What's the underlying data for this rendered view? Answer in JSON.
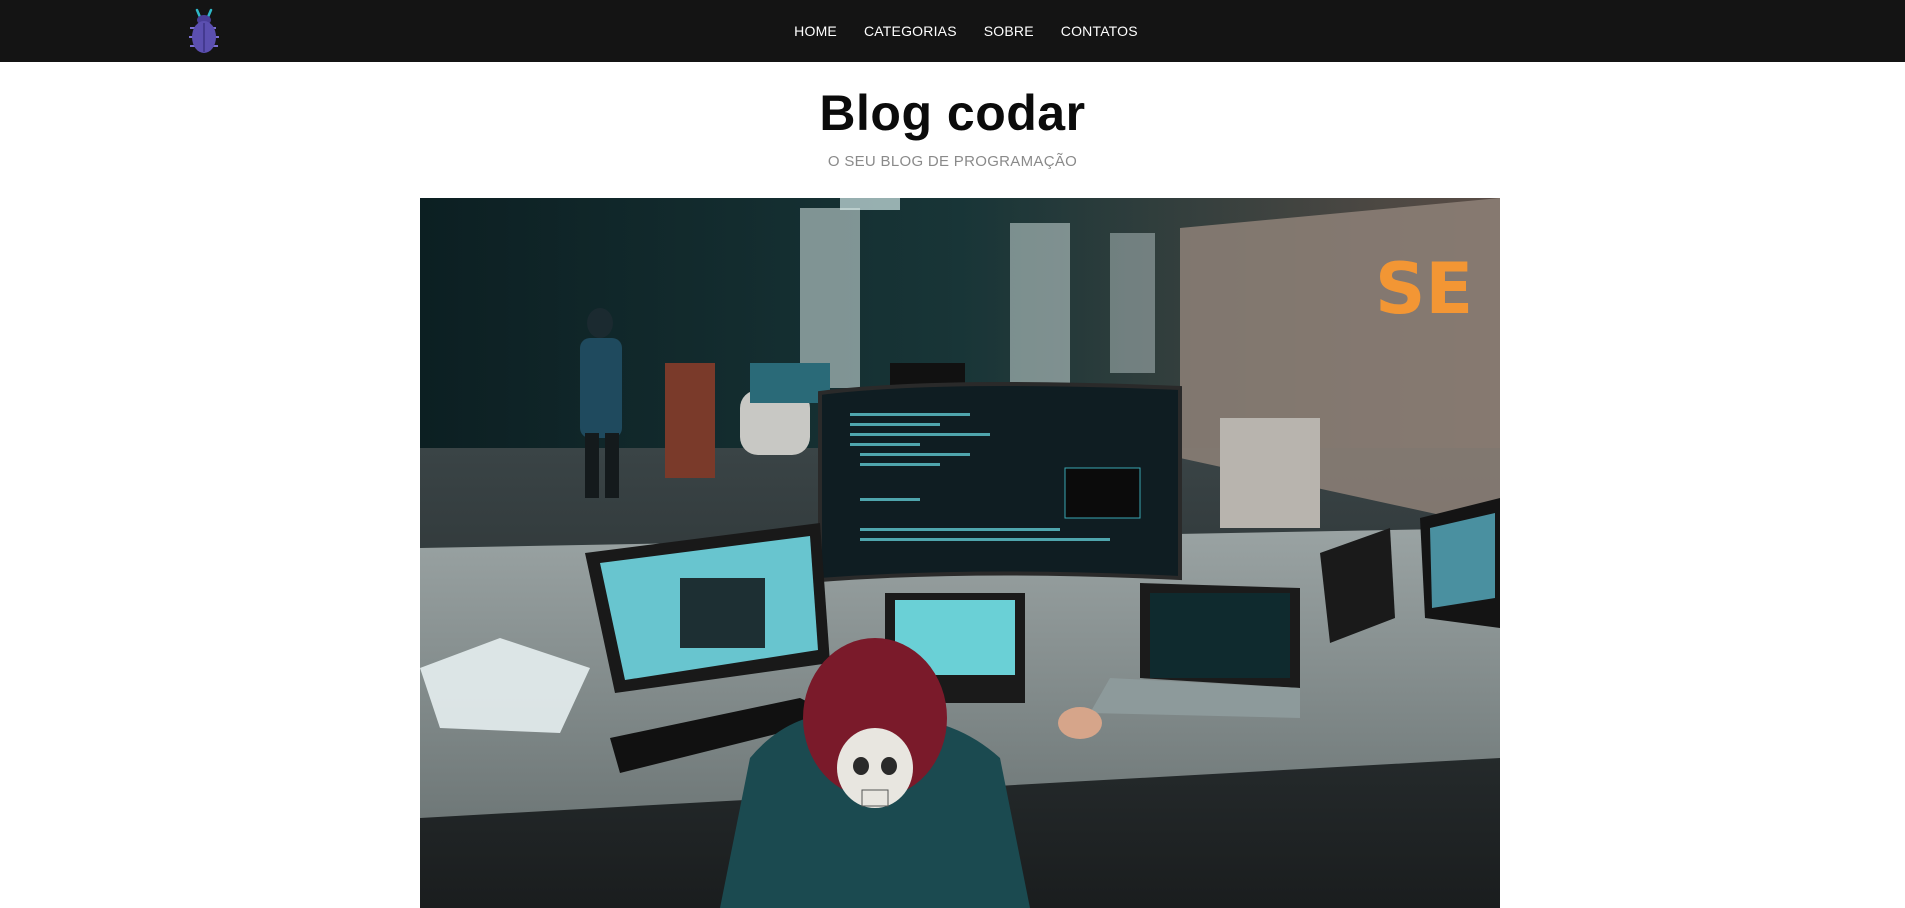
{
  "header": {
    "logo_icon": "bug-icon",
    "nav": [
      {
        "label": "HOME"
      },
      {
        "label": "CATEGORIAS"
      },
      {
        "label": "SOBRE"
      },
      {
        "label": "CONTATOS"
      }
    ]
  },
  "main": {
    "title": "Blog codar",
    "subtitle": "O SEU BLOG DE PROGRAMAÇÃO",
    "hero_image": "office-workspace-photo"
  },
  "colors": {
    "topbar": "#141414",
    "accent": "#5b4fb0",
    "title": "#0b0b0b",
    "subtitle": "#8a8a8a"
  }
}
